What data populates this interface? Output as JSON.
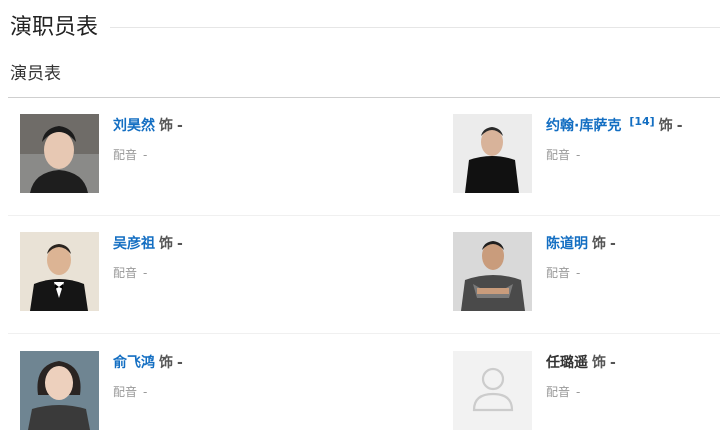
{
  "section": {
    "title": "演职员表"
  },
  "subsection": {
    "title": "演员表"
  },
  "cast": [
    {
      "name": "刘昊然",
      "ref": "",
      "role_label": "饰",
      "role": "-",
      "dub_label": "配音",
      "dub": "-",
      "photo": "photo"
    },
    {
      "name": "约翰·库萨克",
      "ref": "[14]",
      "role_label": "饰",
      "role": "-",
      "dub_label": "配音",
      "dub": "-",
      "photo": "photo"
    },
    {
      "name": "吴彦祖",
      "ref": "",
      "role_label": "饰",
      "role": "-",
      "dub_label": "配音",
      "dub": "-",
      "photo": "photo"
    },
    {
      "name": "陈道明",
      "ref": "",
      "role_label": "饰",
      "role": "-",
      "dub_label": "配音",
      "dub": "-",
      "photo": "photo"
    },
    {
      "name": "俞飞鸿",
      "ref": "",
      "role_label": "饰",
      "role": "-",
      "dub_label": "配音",
      "dub": "-",
      "photo": "photo"
    },
    {
      "name": "任璐遥",
      "ref": "",
      "role_label": "饰",
      "role": "-",
      "dub_label": "配音",
      "dub": "-",
      "photo": "placeholder-person-icon"
    }
  ],
  "colors": {
    "link": "#136ec2",
    "muted": "#999999",
    "placeholder_bg": "#f2f2f2"
  }
}
